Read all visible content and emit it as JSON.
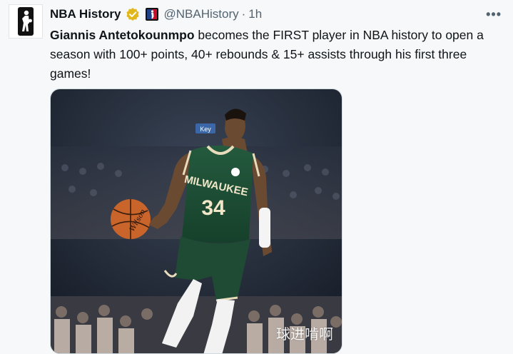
{
  "tweet": {
    "author_name": "NBA History",
    "handle": "@NBAHistory",
    "separator": "·",
    "time": "1h",
    "more_label": "•••",
    "text_bold": "Giannis Antetokounmpo",
    "text_rest": " becomes the FIRST player in NBA history to open a season with 100+ points, 40+ rebounds & 15+ assists through his first three games!"
  },
  "media": {
    "jersey_team": "MILWAUKEE",
    "jersey_number": "34",
    "ball_brand": "Wilson",
    "arena_sign": "Key"
  },
  "watermark": "球进啃啊",
  "icons": {
    "avatar": "nba-logo-icon",
    "verified": "verified-badge-icon",
    "affiliate": "nba-affiliate-icon",
    "more": "more-options-icon"
  },
  "colors": {
    "verified_gold": "#e2b719",
    "bucks_green": "#1f4a33",
    "nba_blue": "#1d428a",
    "nba_red": "#c8102e"
  }
}
